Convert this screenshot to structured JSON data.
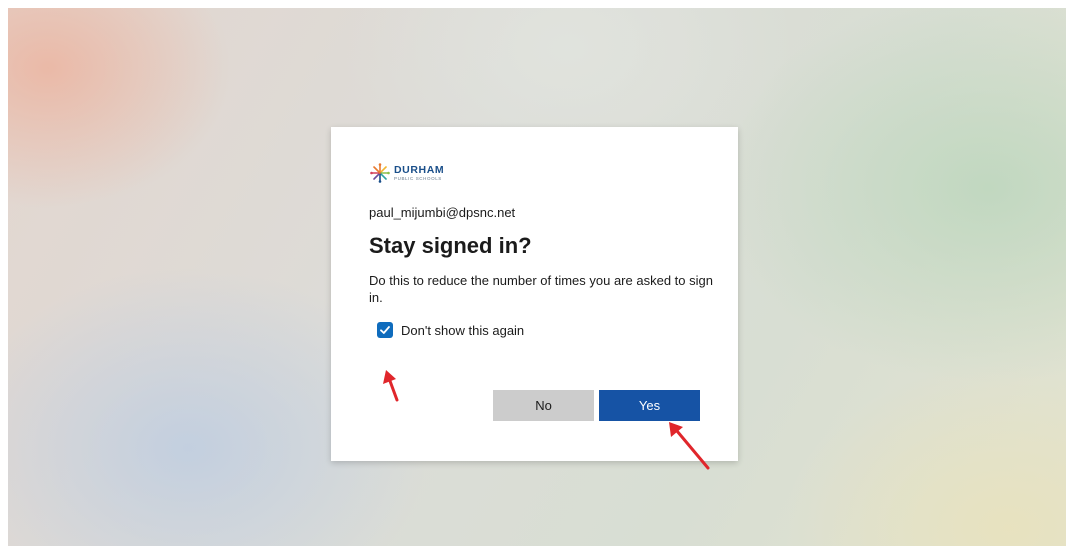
{
  "logo": {
    "name": "DURHAM",
    "subtitle": "PUBLIC SCHOOLS"
  },
  "account": {
    "email": "paul_mijumbi@dpsnc.net"
  },
  "prompt": {
    "title": "Stay signed in?",
    "description": "Do this to reduce the number of times you are asked to sign in."
  },
  "checkbox": {
    "label": "Don't show this again",
    "checked": true
  },
  "buttons": {
    "no_label": "No",
    "yes_label": "Yes"
  },
  "colors": {
    "primary": "#1653a5",
    "checkbox": "#0f6cbd",
    "secondary_button": "#cccccc",
    "annotation_arrow": "#e0262b"
  },
  "icons": {
    "logo_mark": "starburst-logo-icon",
    "check": "checkmark-icon",
    "annotation": "red-arrow-icon"
  }
}
